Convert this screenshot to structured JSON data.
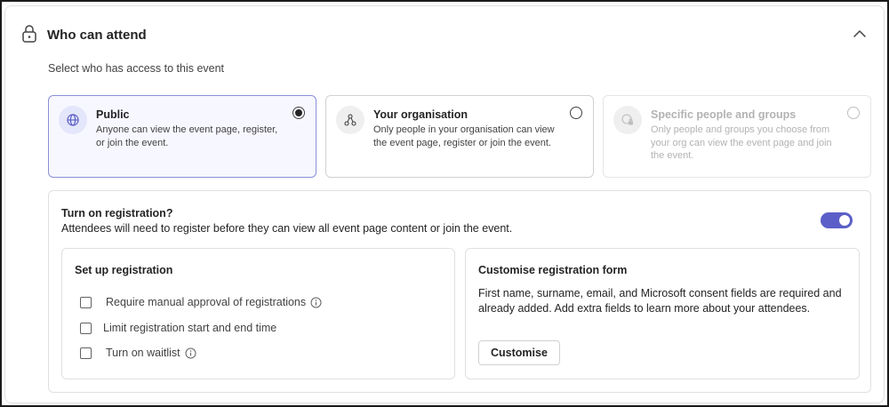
{
  "section": {
    "title": "Who can attend",
    "subtitle": "Select who has access to this event"
  },
  "options": [
    {
      "title": "Public",
      "description": "Anyone can view the event page, register, or join the event.",
      "icon": "globe-icon",
      "selected": true,
      "disabled": false
    },
    {
      "title": "Your organisation",
      "description": "Only people in your organisation can view the event page, register or join the event.",
      "icon": "organization-icon",
      "selected": false,
      "disabled": false
    },
    {
      "title": "Specific people and groups",
      "description": "Only people and groups you choose from your org can view the event page and join the event.",
      "icon": "people-lock-icon",
      "selected": false,
      "disabled": true
    }
  ],
  "registration": {
    "title": "Turn on registration?",
    "description": "Attendees will need to register before they can view all event page content or join the event.",
    "enabled": true,
    "setup": {
      "title": "Set up registration",
      "items": [
        {
          "label": "Require manual approval of registrations",
          "info": true,
          "checked": false
        },
        {
          "label": "Limit registration start and end time",
          "info": false,
          "checked": false
        },
        {
          "label": "Turn on waitlist",
          "info": true,
          "checked": false
        }
      ]
    },
    "customise": {
      "title": "Customise registration form",
      "description": "First name, surname, email, and Microsoft consent fields are required and already added. Add extra fields to learn more about your attendees.",
      "button_label": "Customise"
    }
  },
  "colors": {
    "accent": "#5b5fc7",
    "selected_border": "#8a8fd8"
  }
}
